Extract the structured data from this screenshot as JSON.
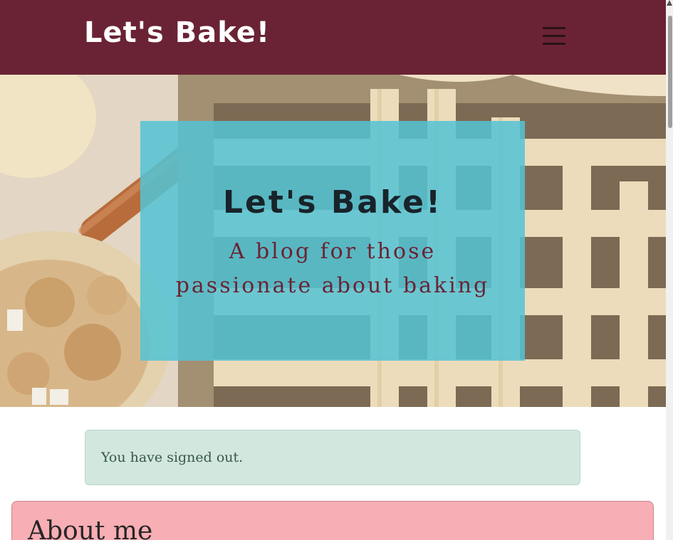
{
  "navbar": {
    "brand": "Let's Bake!",
    "toggle_icon": "hamburger-menu-icon"
  },
  "hero": {
    "title": "Let's Bake!",
    "subtitle_line1": "A blog for those",
    "subtitle_line2": "passionate about baking",
    "image": "lattice-pie-and-rolling-pin"
  },
  "alert": {
    "message": "You have signed out."
  },
  "about": {
    "title": "About me"
  },
  "colors": {
    "navbar": "#6a2334",
    "hero_box": "#54c4d4",
    "alert_bg": "#d2e7dd",
    "about_bg": "#f7aeb4"
  }
}
